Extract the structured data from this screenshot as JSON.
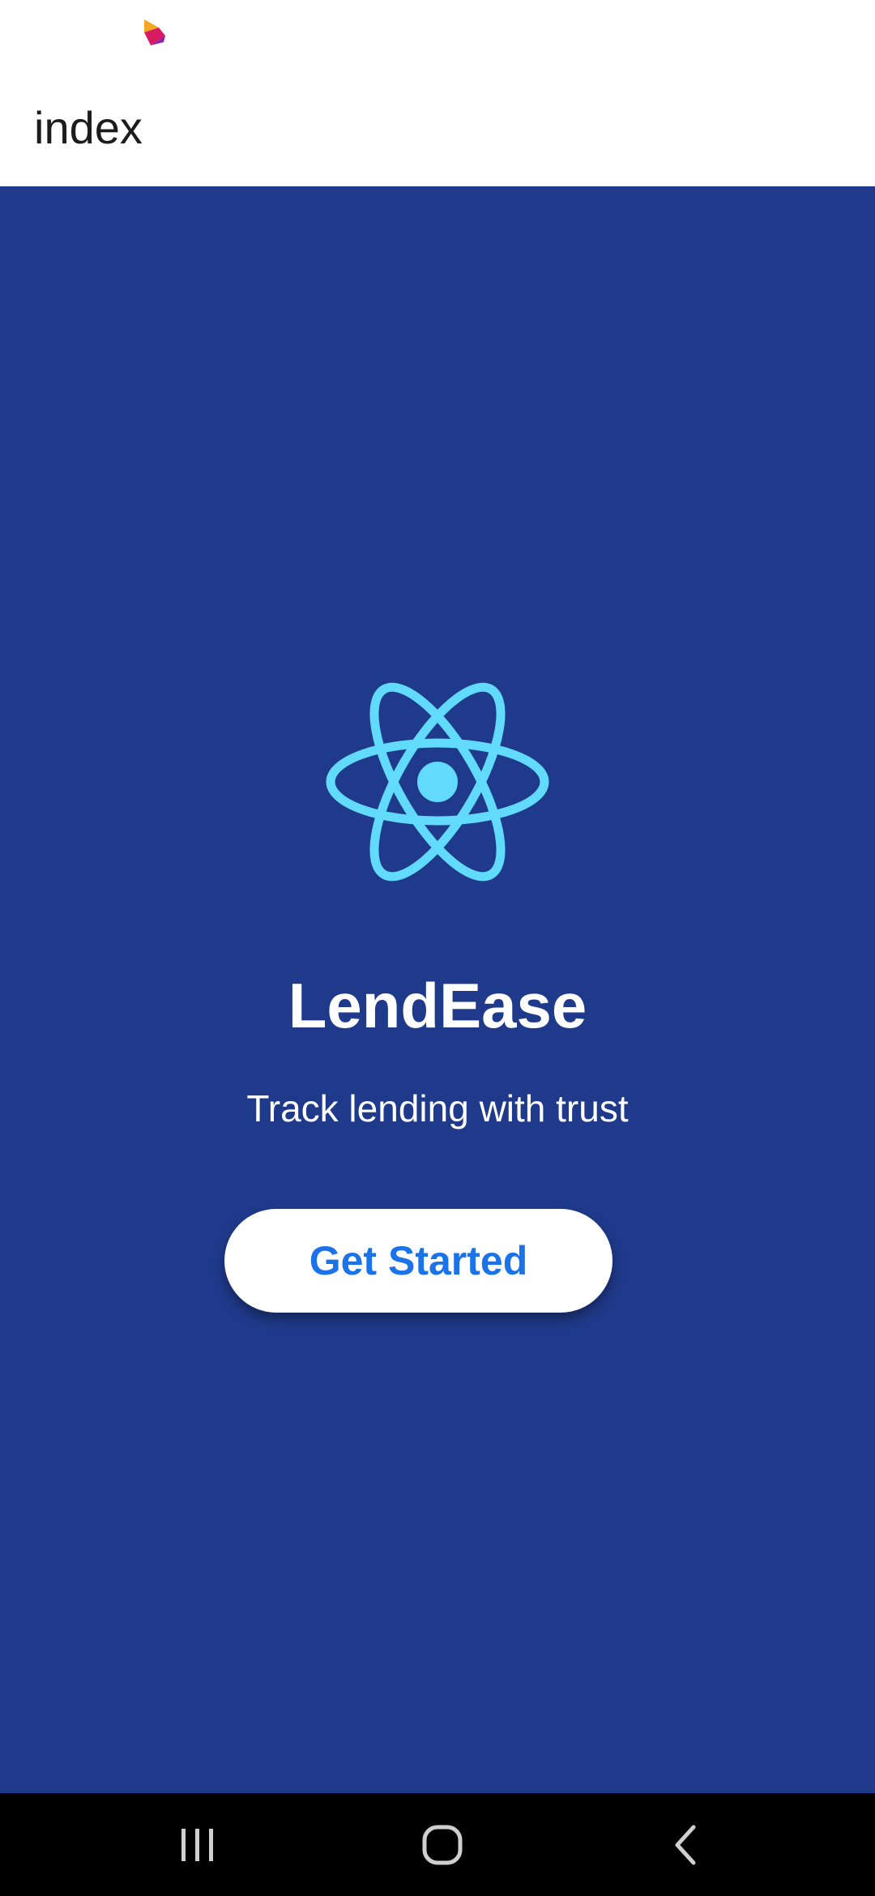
{
  "status_bar": {
    "logo_icon": "app-logo-icon"
  },
  "header": {
    "title": "index"
  },
  "main": {
    "logo_icon": "react-atom-icon",
    "app_name": "LendEase",
    "tagline": "Track lending with trust",
    "cta_label": "Get Started"
  },
  "nav_bar": {
    "recents_icon": "recents-icon",
    "home_icon": "home-icon",
    "back_icon": "back-icon"
  },
  "colors": {
    "background": "#1f3a8a",
    "accent": "#61dafb",
    "button_text": "#1a73e8",
    "button_bg": "#ffffff"
  }
}
